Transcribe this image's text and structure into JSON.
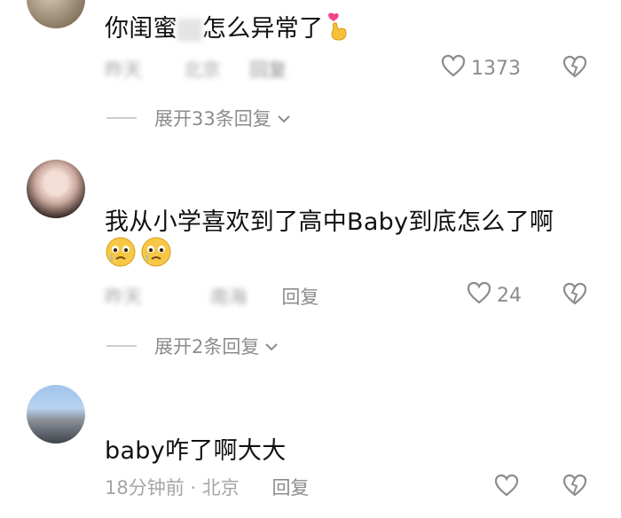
{
  "comments": [
    {
      "username": "",
      "text": "你闺蜜",
      "text_tail": "怎么异常了",
      "meta_time": "昨天",
      "meta_location": "北京",
      "reply_label": "回复",
      "likes": "1373",
      "expand_label": "展开33条回复"
    },
    {
      "username": "",
      "text": "我从小学喜欢到了高中Baby到底怎么了啊",
      "meta_time": "昨天",
      "meta_location": "南海",
      "reply_label": "回复",
      "likes": "24",
      "expand_label": "展开2条回复"
    },
    {
      "username": "",
      "text": "baby咋了啊大大",
      "meta": "18分钟前 · 北京",
      "reply_label": "回复"
    }
  ],
  "colors": {
    "like": "#8c8c8c",
    "meta": "#a5a5a5",
    "text": "#111111"
  },
  "icons": [
    "heart-icon",
    "broken-heart-icon",
    "chevron-down-icon",
    "finger-heart-emoji",
    "crying-emoji"
  ]
}
